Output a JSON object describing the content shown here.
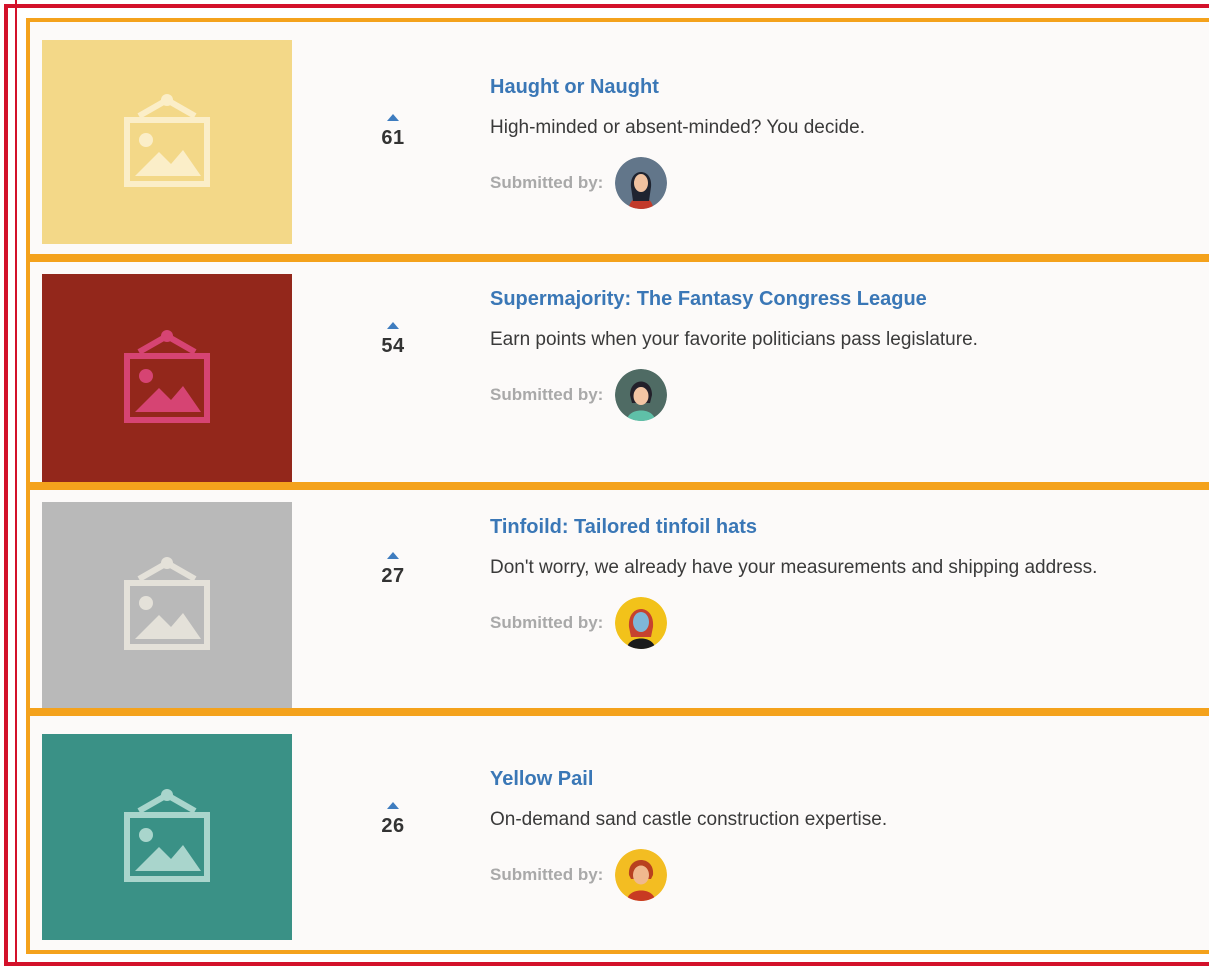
{
  "items": [
    {
      "title": "Haught or Naught",
      "description": "High-minded or absent-minded? You decide.",
      "votes": "61",
      "submitted_label": "Submitted by:",
      "thumb_color": "#f3d888",
      "thumb_icon_color": "#fbeec8",
      "thumb_icon": "image-placeholder-icon",
      "avatar_bg": "#62768a"
    },
    {
      "title": "Supermajority: The Fantasy Congress League",
      "description": "Earn points when your favorite politicians pass legislature.",
      "votes": "54",
      "submitted_label": "Submitted by:",
      "thumb_color": "#93271b",
      "thumb_icon_color": "#d64473",
      "thumb_icon": "image-placeholder-icon",
      "avatar_bg": "#4f6b64"
    },
    {
      "title": "Tinfoild: Tailored tinfoil hats",
      "description": "Don't worry, we already have your measurements and shipping address.",
      "votes": "27",
      "submitted_label": "Submitted by:",
      "thumb_color": "#b9b9b9",
      "thumb_icon_color": "#e4e1d9",
      "thumb_icon": "image-placeholder-icon",
      "avatar_bg": "#f2c21a"
    },
    {
      "title": "Yellow Pail",
      "description": "On-demand sand castle construction expertise.",
      "votes": "26",
      "submitted_label": "Submitted by:",
      "thumb_color": "#3a9186",
      "thumb_icon_color": "#a9d5cc",
      "thumb_icon": "image-placeholder-icon",
      "avatar_bg": "#f3bd22"
    }
  ],
  "colors": {
    "outer_border": "#d3112a",
    "item_border": "#f4a21c",
    "title": "#3a77b6",
    "vote_arrow": "#3e7cbf"
  }
}
